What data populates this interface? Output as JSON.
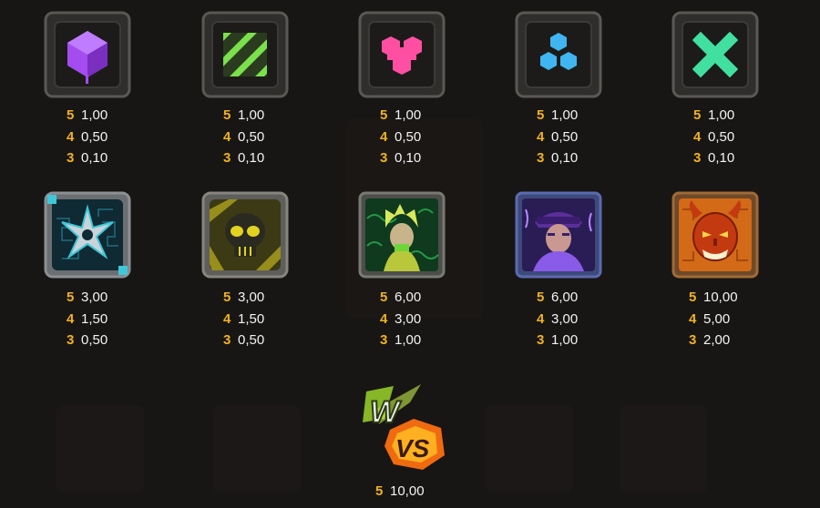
{
  "symbols": [
    {
      "id": "purple-cube",
      "icon": "purple-cube-icon",
      "color": "#a44cf0",
      "pays": [
        {
          "count": "5",
          "value": "1,00"
        },
        {
          "count": "4",
          "value": "0,50"
        },
        {
          "count": "3",
          "value": "0,10"
        }
      ]
    },
    {
      "id": "green-stripes",
      "icon": "green-stripes-icon",
      "color": "#7be04b",
      "pays": [
        {
          "count": "5",
          "value": "1,00"
        },
        {
          "count": "4",
          "value": "0,50"
        },
        {
          "count": "3",
          "value": "0,10"
        }
      ]
    },
    {
      "id": "pink-trefoil",
      "icon": "pink-trefoil-icon",
      "color": "#ff4fa3",
      "pays": [
        {
          "count": "5",
          "value": "1,00"
        },
        {
          "count": "4",
          "value": "0,50"
        },
        {
          "count": "3",
          "value": "0,10"
        }
      ]
    },
    {
      "id": "blue-hexagons",
      "icon": "blue-hexagons-icon",
      "color": "#3fb6ef",
      "pays": [
        {
          "count": "5",
          "value": "1,00"
        },
        {
          "count": "4",
          "value": "0,50"
        },
        {
          "count": "3",
          "value": "0,10"
        }
      ]
    },
    {
      "id": "green-cross",
      "icon": "green-cross-icon",
      "color": "#42e0a0",
      "pays": [
        {
          "count": "5",
          "value": "1,00"
        },
        {
          "count": "4",
          "value": "0,50"
        },
        {
          "count": "3",
          "value": "0,10"
        }
      ]
    },
    {
      "id": "shuriken",
      "icon": "shuriken-icon",
      "color": "#3fc7d8",
      "pays": [
        {
          "count": "5",
          "value": "3,00"
        },
        {
          "count": "4",
          "value": "1,50"
        },
        {
          "count": "3",
          "value": "0,50"
        }
      ]
    },
    {
      "id": "skull",
      "icon": "skull-icon",
      "color": "#e3d321",
      "pays": [
        {
          "count": "5",
          "value": "3,00"
        },
        {
          "count": "4",
          "value": "1,50"
        },
        {
          "count": "3",
          "value": "0,50"
        }
      ]
    },
    {
      "id": "green-ninja",
      "icon": "green-ninja-icon",
      "color": "#6fd43a",
      "pays": [
        {
          "count": "5",
          "value": "6,00"
        },
        {
          "count": "4",
          "value": "3,00"
        },
        {
          "count": "3",
          "value": "1,00"
        }
      ]
    },
    {
      "id": "purple-fighter",
      "icon": "purple-fighter-icon",
      "color": "#8a5ae8",
      "pays": [
        {
          "count": "5",
          "value": "6,00"
        },
        {
          "count": "4",
          "value": "3,00"
        },
        {
          "count": "3",
          "value": "1,00"
        }
      ]
    },
    {
      "id": "oni-mask",
      "icon": "oni-mask-icon",
      "color": "#e0581e",
      "pays": [
        {
          "count": "5",
          "value": "10,00"
        },
        {
          "count": "4",
          "value": "5,00"
        },
        {
          "count": "3",
          "value": "2,00"
        }
      ]
    }
  ],
  "wild": {
    "icon": "wild-vs-icon",
    "wild_letter": "W",
    "vs_text": "VS",
    "pays": [
      {
        "count": "5",
        "value": "10,00"
      }
    ]
  }
}
